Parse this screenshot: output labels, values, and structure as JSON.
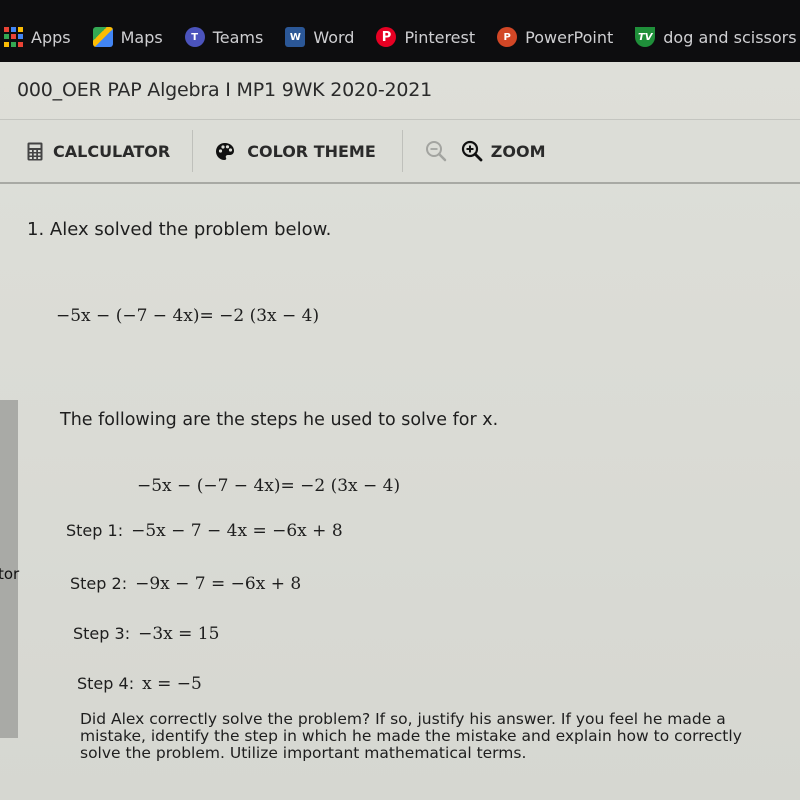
{
  "bookmarks": [
    {
      "label": "Apps",
      "icon": "apps-grid-icon"
    },
    {
      "label": "Maps",
      "icon": "maps-icon"
    },
    {
      "label": "Teams",
      "icon": "teams-icon",
      "glyph": "T"
    },
    {
      "label": "Word",
      "icon": "word-icon",
      "glyph": "W"
    },
    {
      "label": "Pinterest",
      "icon": "pinterest-icon",
      "glyph": "P"
    },
    {
      "label": "PowerPoint",
      "icon": "powerpoint-icon",
      "glyph": "P"
    },
    {
      "label": "dog and scissors",
      "icon": "tv-icon",
      "glyph": "TV"
    }
  ],
  "page": {
    "title": "000_OER PAP Algebra I MP1 9WK 2020-2021"
  },
  "toolbar": {
    "calculator_label": "CALCULATOR",
    "color_theme_label": "COLOR THEME",
    "zoom_label": "ZOOM"
  },
  "question": {
    "heading": "1. Alex solved the problem below.",
    "equation": "−5x − (−7 − 4x)= −2 (3x − 4)",
    "steps_intro": "The following are the steps he used to solve for x.",
    "equation_repeat": "−5x − (−7 − 4x)= −2 (3x − 4)",
    "steps": [
      {
        "label": "Step 1:",
        "expr": "−5x − 7 − 4x = −6x + 8"
      },
      {
        "label": "Step 2:",
        "expr": "−9x − 7 = −6x + 8"
      },
      {
        "label": "Step 3:",
        "expr": "−3x = 15"
      },
      {
        "label": "Step 4:",
        "expr": "x = −5"
      }
    ],
    "prompt": "Did Alex correctly solve the problem? If so, justify his answer. If you feel he made a mistake, identify the step in which he made the mistake and explain how to correctly solve the problem. Utilize important mathematical terms."
  },
  "background_window": {
    "partial_text": "tor"
  }
}
